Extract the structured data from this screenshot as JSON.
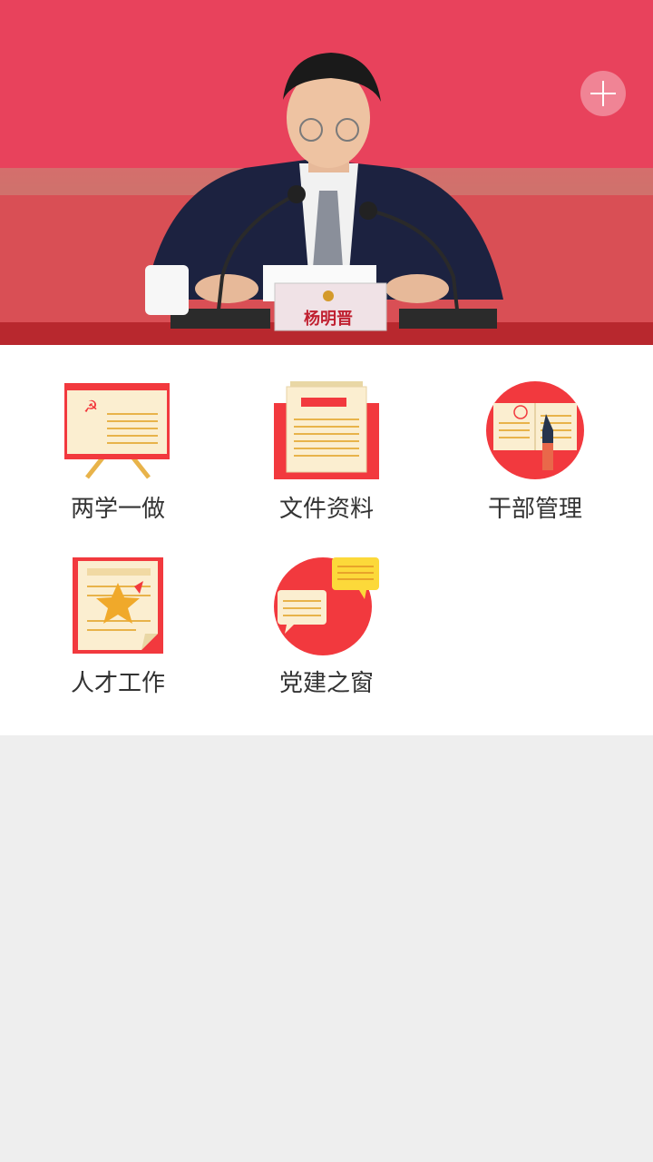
{
  "banner": {
    "nameplate": "杨明晋"
  },
  "menu": {
    "items": [
      {
        "label": "两学一做",
        "icon": "party-whiteboard-icon"
      },
      {
        "label": "文件资料",
        "icon": "documents-icon"
      },
      {
        "label": "干部管理",
        "icon": "notebook-pen-icon"
      },
      {
        "label": "人才工作",
        "icon": "star-certificate-icon"
      },
      {
        "label": "党建之窗",
        "icon": "chat-bubbles-icon"
      }
    ]
  },
  "colors": {
    "accent_red": "#f2393e",
    "paper": "#fbeed0",
    "gold": "#e8b34a",
    "background": "#eeeeee"
  }
}
